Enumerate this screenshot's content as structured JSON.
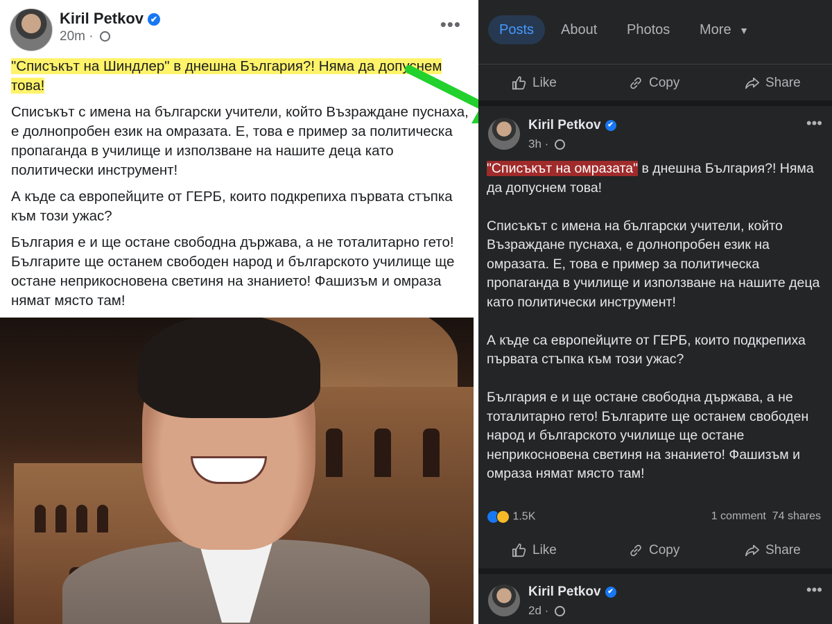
{
  "left_post": {
    "author": "Kiril Petkov",
    "verified_badge": "✔",
    "time": "20m",
    "menu": "•••",
    "headline": "\"Списъкът на Шиндлер\" в днешна България?! Няма да допуснем това!",
    "paragraphs": [
      "Списъкът с имена на български учители, който Възраждане пуснаха, е долнопробен език на омразата. Е, това е пример за политическа пропаганда в училище и използване на нашите деца като политически инструмент!",
      "А къде са европейците от ГЕРБ, които подкрепиха първата стъпка към този ужас?",
      "България е и ще остане свободна държава, а не тоталитарно гето! Българите ще останем свободен народ и българското училище ще остане неприкосновена светиня на знанието! Фашизъм и омраза нямат място там!"
    ]
  },
  "arrow": {
    "color": "#22d12e"
  },
  "right_panel": {
    "tabs": [
      {
        "label": "Posts",
        "active": true
      },
      {
        "label": "About"
      },
      {
        "label": "Photos"
      },
      {
        "label": "More"
      }
    ],
    "action_labels": {
      "like": "Like",
      "copy": "Copy",
      "share": "Share"
    },
    "post": {
      "author": "Kiril Petkov",
      "verified_badge": "✔",
      "time": "3h",
      "menu": "•••",
      "headline_highlight": "\"Списъкът на омразата\"",
      "headline_rest": " в днешна България?! Няма да допуснем това!",
      "paragraphs": [
        "Списъкът с имена на български учители, който Възраждане пуснаха, е долнопробен език на омразата. Е, това е пример за политическа пропаганда в училище и използване на нашите деца като политически инструмент!",
        "А къде са европейците от ГЕРБ, които подкрепиха първата стъпка към този ужас?",
        "България е и ще остане свободна държава, а не тоталитарно гето! Българите ще останем свободен народ и българското училище ще остане неприкосновена светиня на знанието! Фашизъм и омраза нямат място там!"
      ],
      "reaction_count": "1.5K",
      "comments": "1 comment",
      "shares": "74 shares"
    },
    "next_post": {
      "author": "Kiril Petkov",
      "verified_badge": "✔",
      "time": "2d",
      "menu": "•••"
    }
  },
  "colors": {
    "highlight_yellow": "#fff36a",
    "highlight_red": "#a02b2b",
    "verified": "#1877f2",
    "dark_bg": "#242526"
  }
}
